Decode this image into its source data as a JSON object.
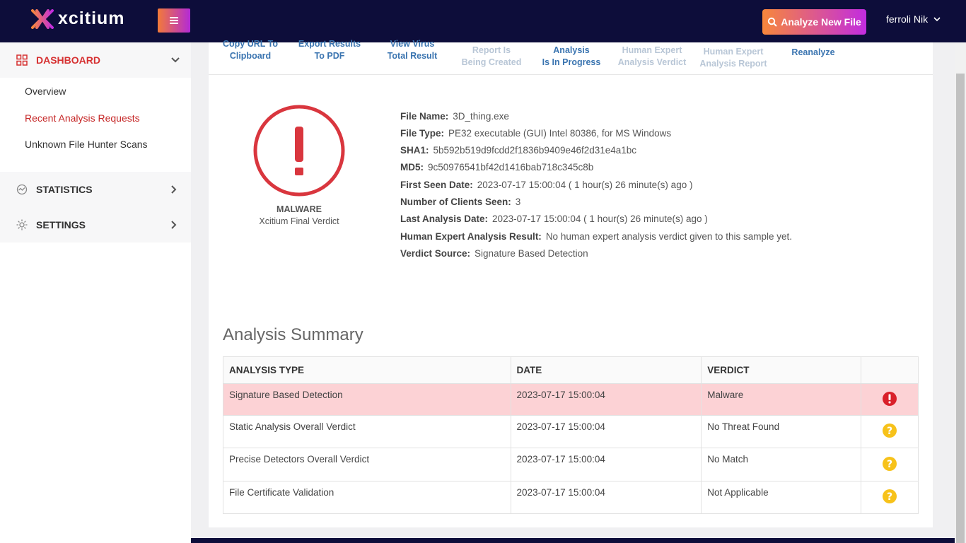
{
  "header": {
    "brand": "xcitium",
    "analyze_button": "Analyze New File",
    "user_name": "ferroli Nik"
  },
  "sidebar": {
    "dashboard_label": "DASHBOARD",
    "dashboard_items": [
      "Overview",
      "Recent Analysis Requests",
      "Unknown File Hunter Scans"
    ],
    "statistics_label": "STATISTICS",
    "settings_label": "SETTINGS"
  },
  "actions": {
    "copy_url": [
      "Copy URL To",
      "Clipboard"
    ],
    "export_pdf": [
      "Export Results",
      "To PDF"
    ],
    "view_vt": [
      "View Virus",
      "Total Result"
    ],
    "report_created": [
      "Report Is",
      "Being Created"
    ],
    "analysis_progress": [
      "Analysis",
      "Is In Progress"
    ],
    "human_verdict": [
      "Human Expert",
      "Analysis Verdict"
    ],
    "human_report": [
      "Human Expert",
      "Analysis Report"
    ],
    "reanalyze": "Reanalyze"
  },
  "verdict": {
    "label": "MALWARE",
    "sub": "Xcitium Final Verdict"
  },
  "file_info": {
    "file_name_label": "File Name:",
    "file_name": "3D_thing.exe",
    "file_type_label": "File Type:",
    "file_type": "PE32 executable (GUI) Intel 80386, for MS Windows",
    "sha1_label": "SHA1:",
    "sha1": "5b592b519d9fcdd2f1836b9409e46f2d31e4a1bc",
    "md5_label": "MD5:",
    "md5": "9c50976541bf42d1416bab718c345c8b",
    "first_seen_label": "First Seen Date:",
    "first_seen": "2023-07-17 15:00:04 ( 1 hour(s) 26 minute(s) ago )",
    "clients_label": "Number of Clients Seen:",
    "clients": "3",
    "last_analysis_label": "Last Analysis Date:",
    "last_analysis": "2023-07-17 15:00:04 ( 1 hour(s) 26 minute(s) ago )",
    "human_result_label": "Human Expert Analysis Result:",
    "human_result": "No human expert analysis verdict given to this sample yet.",
    "verdict_source_label": "Verdict Source:",
    "verdict_source": "Signature Based Detection"
  },
  "summary": {
    "title": "Analysis Summary",
    "columns": [
      "ANALYSIS TYPE",
      "DATE",
      "VERDICT"
    ],
    "rows": [
      {
        "type": "Signature Based Detection",
        "date": "2023-07-17 15:00:04",
        "verdict": "Malware",
        "icon": "alert-icon"
      },
      {
        "type": "Static Analysis Overall Verdict",
        "date": "2023-07-17 15:00:04",
        "verdict": "No Threat Found",
        "icon": "question-icon"
      },
      {
        "type": "Precise Detectors Overall Verdict",
        "date": "2023-07-17 15:00:04",
        "verdict": "No Match",
        "icon": "question-icon"
      },
      {
        "type": "File Certificate Validation",
        "date": "2023-07-17 15:00:04",
        "verdict": "Not Applicable",
        "icon": "question-icon"
      }
    ]
  },
  "colors": {
    "navy": "#0d0d3a",
    "danger": "#d9363e",
    "warning": "#f7c21a",
    "link_blue": "#3a74b0"
  }
}
